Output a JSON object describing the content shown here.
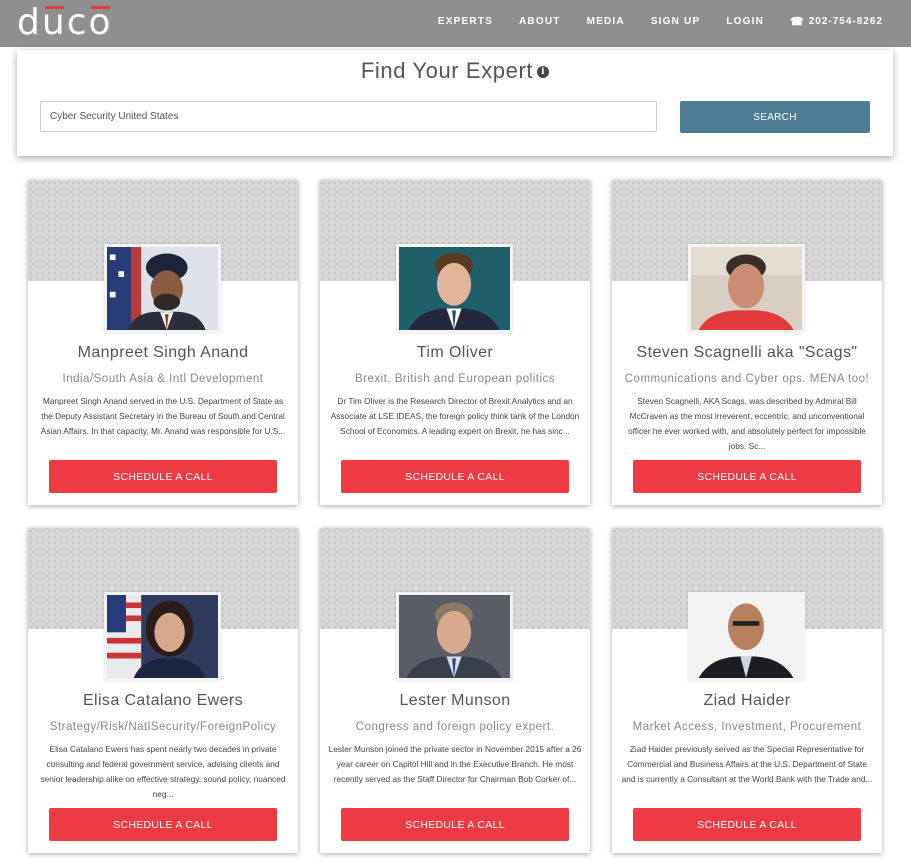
{
  "header": {
    "logo_text": "duco",
    "logo_accent": "#e23c3c",
    "nav": [
      "EXPERTS",
      "ABOUT",
      "MEDIA",
      "SIGN UP",
      "LOGIN"
    ],
    "phone_icon": "phone-icon",
    "phone": "202-754-8262"
  },
  "search": {
    "title": "Find Your Expert",
    "info_icon": "info-icon",
    "input_value": "Cyber Security United States",
    "button_label": "SEARCH",
    "button_color": "#4e7c92"
  },
  "cta_color": "#ee3a43",
  "experts": [
    {
      "name": "Manpreet Singh Anand",
      "tagline": "India/South Asia & Intl Development",
      "bio": "Manpreet Singh Anand served in the U.S. Department of State as the Deputy Assistant Secretary in the Bureau of South and Central Asian Affairs. In that capacity, Mr. Anand was responsible for U.S...",
      "cta": "SCHEDULE A CALL"
    },
    {
      "name": "Tim Oliver",
      "tagline": "Brexit, British and European politics",
      "bio": "Dr Tim Oliver is the Research Director of Brexit Analytics and an Associate at LSE IDEAS, the foreign policy think tank of the London School of Economics. A leading expert on Brexit, he has sinc...",
      "cta": "SCHEDULE A CALL"
    },
    {
      "name": "Steven Scagnelli aka \"Scags\"",
      "tagline": "Communications and Cyber ops. MENA too!",
      "bio": "Steven Scagnelli, AKA Scags, was described by Admiral Bill McCraven as the most irreverent, eccentric, and unconventional officer he ever worked with, and absolutely perfect for impossible jobs. Sc...",
      "cta": "SCHEDULE A CALL"
    },
    {
      "name": "Elisa Catalano Ewers",
      "tagline": "Strategy/Risk/NatlSecurity/ForeignPolicy",
      "bio": "Elisa Catalano Ewers has spent nearly two decades in private consulting and federal government service, advising clients and senior leadership alike on effective strategy, sound policy, nuanced neg...",
      "cta": "SCHEDULE A CALL"
    },
    {
      "name": "Lester Munson",
      "tagline": "Congress and foreign policy expert.",
      "bio": "Lester Munson joined the private sector in November 2015 after a 26 year career on Capitol Hill and in the Executive Branch. He most recently served as the Staff Director for Chairman Bob Corker of...",
      "cta": "SCHEDULE A CALL"
    },
    {
      "name": "Ziad Haider",
      "tagline": "Market Access, Investment, Procurement",
      "bio": "Ziad Haider previously served as the Special Representative for Commercial and Business Affairs at the U.S. Department of State and is currently a Consultant at the World Bank with the Trade and...",
      "cta": "SCHEDULE A CALL"
    }
  ]
}
